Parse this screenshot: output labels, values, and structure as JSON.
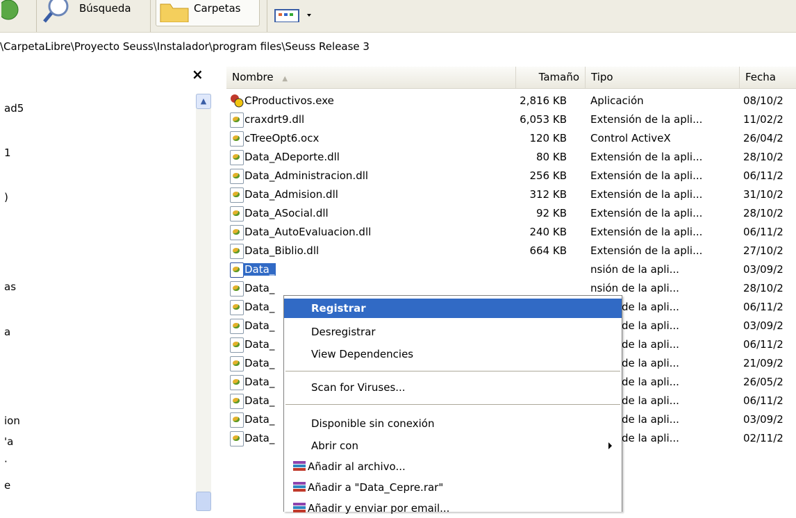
{
  "toolbar": {
    "search_label": "Búsqueda",
    "folders_label": "Carpetas"
  },
  "address": "\\CarpetaLibre\\Proyecto Seuss\\Instalador\\program files\\Seuss Release 3",
  "folders_panel": {
    "close": "×",
    "items": [
      "ad5",
      "1",
      ")",
      "as",
      "a",
      "ion",
      "'a",
      "·",
      "e"
    ]
  },
  "columns": {
    "name": "Nombre",
    "size": "Tamaño",
    "type": "Tipo",
    "date": "Fecha"
  },
  "files": [
    {
      "name": "CProductivos.exe",
      "size": "2,816 KB",
      "type": "Aplicación",
      "date": "08/10/2"
    },
    {
      "name": "craxdrt9.dll",
      "size": "6,053 KB",
      "type": "Extensión de la apli...",
      "date": "11/02/2"
    },
    {
      "name": "cTreeOpt6.ocx",
      "size": "120 KB",
      "type": "Control ActiveX",
      "date": "26/04/2"
    },
    {
      "name": "Data_ADeporte.dll",
      "size": "80 KB",
      "type": "Extensión de la apli...",
      "date": "28/10/2"
    },
    {
      "name": "Data_Administracion.dll",
      "size": "256 KB",
      "type": "Extensión de la apli...",
      "date": "06/11/2"
    },
    {
      "name": "Data_Admision.dll",
      "size": "312 KB",
      "type": "Extensión de la apli...",
      "date": "31/10/2"
    },
    {
      "name": "Data_ASocial.dll",
      "size": "92 KB",
      "type": "Extensión de la apli...",
      "date": "28/10/2"
    },
    {
      "name": "Data_AutoEvaluacion.dll",
      "size": "240 KB",
      "type": "Extensión de la apli...",
      "date": "06/11/2"
    },
    {
      "name": "Data_Biblio.dll",
      "size": "664 KB",
      "type": "Extensión de la apli...",
      "date": "27/10/2"
    },
    {
      "name": "Data_",
      "size": "",
      "type": "nsión de la apli...",
      "date": "03/09/2"
    },
    {
      "name": "Data_",
      "size": "",
      "type": "nsión de la apli...",
      "date": "28/10/2"
    },
    {
      "name": "Data_",
      "size": "",
      "type": "nsión de la apli...",
      "date": "06/11/2"
    },
    {
      "name": "Data_",
      "size": "",
      "type": "nsión de la apli...",
      "date": "03/09/2"
    },
    {
      "name": "Data_",
      "size": "",
      "type": "nsión de la apli...",
      "date": "06/11/2"
    },
    {
      "name": "Data_",
      "size": "",
      "type": "nsión de la apli...",
      "date": "21/09/2"
    },
    {
      "name": "Data_",
      "size": "",
      "type": "nsión de la apli...",
      "date": "26/05/2"
    },
    {
      "name": "Data_",
      "size": "",
      "type": "nsión de la apli...",
      "date": "06/11/2"
    },
    {
      "name": "Data_",
      "size": "",
      "type": "nsión de la apli...",
      "date": "03/09/2"
    },
    {
      "name": "Data_",
      "size": "",
      "type": "nsión de la apli...",
      "date": "02/11/2"
    }
  ],
  "context_menu": {
    "registrar": "Registrar",
    "desregistrar": "Desregistrar",
    "view_dependencies": "View Dependencies",
    "scan": "Scan for Viruses...",
    "offline": "Disponible sin conexión",
    "open_with": "Abrir con",
    "add_archive": "Añadir al archivo...",
    "add_rar": "Añadir a \"Data_Cepre.rar\"",
    "add_email": "Añadir y enviar por email..."
  },
  "colors": {
    "selection": "#316ac5",
    "toolbar_bg": "#efede3"
  }
}
